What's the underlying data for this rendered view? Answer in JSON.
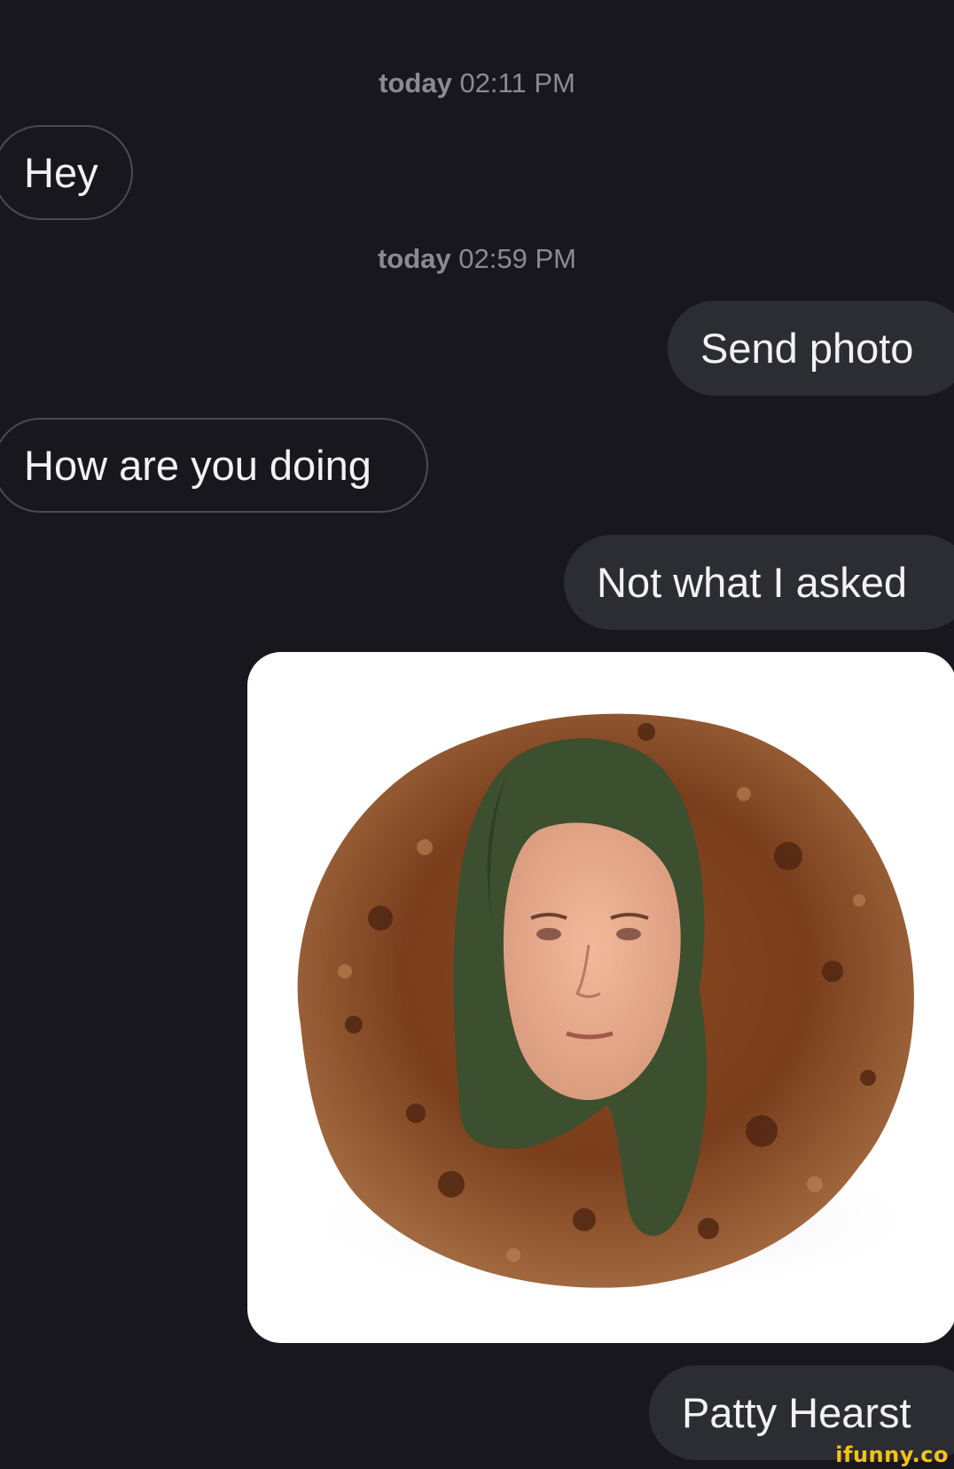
{
  "conversation": {
    "groups": [
      {
        "day": "today",
        "time": "02:11 PM"
      },
      {
        "day": "today",
        "time": "02:59 PM"
      }
    ],
    "messages": [
      {
        "sender": "them",
        "text": "Hey"
      },
      {
        "sender": "me",
        "text": "Send photo"
      },
      {
        "sender": "them",
        "text": "How are you doing"
      },
      {
        "sender": "me",
        "text": "Not what I asked"
      },
      {
        "sender": "me",
        "attachment": "photo of a grilled meat patty with a woman's face"
      },
      {
        "sender": "me",
        "text": "Patty Hearst"
      }
    ]
  },
  "watermark": "ifunny.co",
  "colors": {
    "background": "#17171d",
    "outgoing_bubble": "#2c2c33",
    "incoming_border": "#4a4a52",
    "timestamp": "#8a8a92",
    "watermark": "#f4c21b"
  }
}
